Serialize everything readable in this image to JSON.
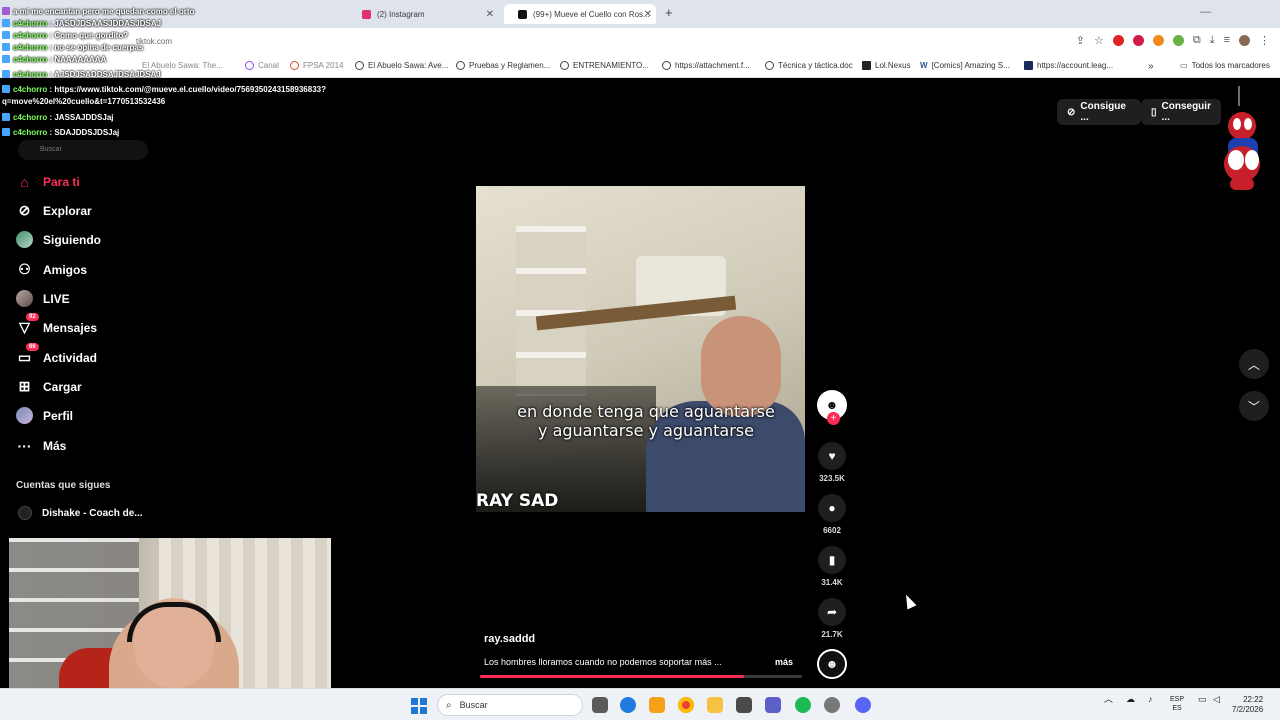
{
  "browser": {
    "tabs": [
      {
        "title": "(2) Instagram",
        "color": "#e1306c"
      },
      {
        "title": "(99+) Mueve el Cuello con Ros...",
        "color": "#111111"
      }
    ],
    "address_partial": "tiktok.com",
    "bookmarks": [
      "El Abuelo Sawa: Ave...",
      "Pruebas y Reglamen...",
      "ENTRENAMIENTO...",
      "https://attachment.f...",
      "Técnica y táctica.doc",
      "Lol.Nexus",
      "[Comics] Amazing S...",
      "https://account.leag...",
      "Todos los marcadores"
    ],
    "bookmarks_partial": [
      "El Abuelo Sawa: The...",
      "Canal",
      "FPSA 2014"
    ]
  },
  "chat": [
    {
      "user": "",
      "text": "a mi me encantan pero me quedan como el orto"
    },
    {
      "user": "c4chorro",
      "text": ": JASDJDSAASJDDASJDSAJ"
    },
    {
      "user": "c4chorro",
      "text": ": Como que gordito?"
    },
    {
      "user": "c4chorro",
      "text": ": no se opina de cuerpas"
    },
    {
      "user": "c4chorro",
      "text": ": NAAAAAAAA"
    },
    {
      "user": "c4chorro",
      "text": ": AJSDJSADDSAJDSAJDSAJ"
    },
    {
      "user": "c4chorro",
      "text": ": https://www.tiktok.com/@mueve.el.cuello/video/7569350243158936833?"
    },
    {
      "user": "",
      "text": "q=move%20el%20cuello&t=1770513532436"
    },
    {
      "user": "c4chorro",
      "text": ": JASSAJDDSJaj"
    },
    {
      "user": "c4chorro",
      "text": ": SDAJDDSJDSJaj"
    }
  ],
  "sidebar": {
    "items": [
      {
        "label": "Para ti",
        "icon": "home-icon"
      },
      {
        "label": "Explorar",
        "icon": "compass-icon"
      },
      {
        "label": "Siguiendo",
        "icon": "following-avatar-icon"
      },
      {
        "label": "Amigos",
        "icon": "friends-icon"
      },
      {
        "label": "LIVE",
        "icon": "live-avatar-icon"
      },
      {
        "label": "Mensajes",
        "icon": "messages-icon",
        "badge": "92"
      },
      {
        "label": "Actividad",
        "icon": "activity-icon",
        "badge": "66"
      },
      {
        "label": "Cargar",
        "icon": "upload-icon"
      },
      {
        "label": "Perfil",
        "icon": "profile-avatar-icon"
      },
      {
        "label": "Más",
        "icon": "more-icon"
      }
    ],
    "section_title": "Cuentas que sigues",
    "following": [
      {
        "name": "Dishake - Coach de..."
      }
    ]
  },
  "header": {
    "pill_coins": "Consigue ...",
    "pill_app": "Conseguir ..."
  },
  "video": {
    "caption": "en donde tenga que aguantarse y aguantarse y aguantarse",
    "watermark": "RAY SAD",
    "author": "ray.saddd",
    "description": "Los hombres lloramos cuando no podemos soportar más ...",
    "more_label": "más",
    "progress": 0.82
  },
  "actions": {
    "likes": "323.5K",
    "comments": "6602",
    "saves": "31.4K",
    "shares": "21.7K"
  },
  "taskbar": {
    "search": "Buscar",
    "lang_line1": "ESP",
    "lang_line2": "ES",
    "time": "22:22",
    "date": "7/2/2026"
  }
}
